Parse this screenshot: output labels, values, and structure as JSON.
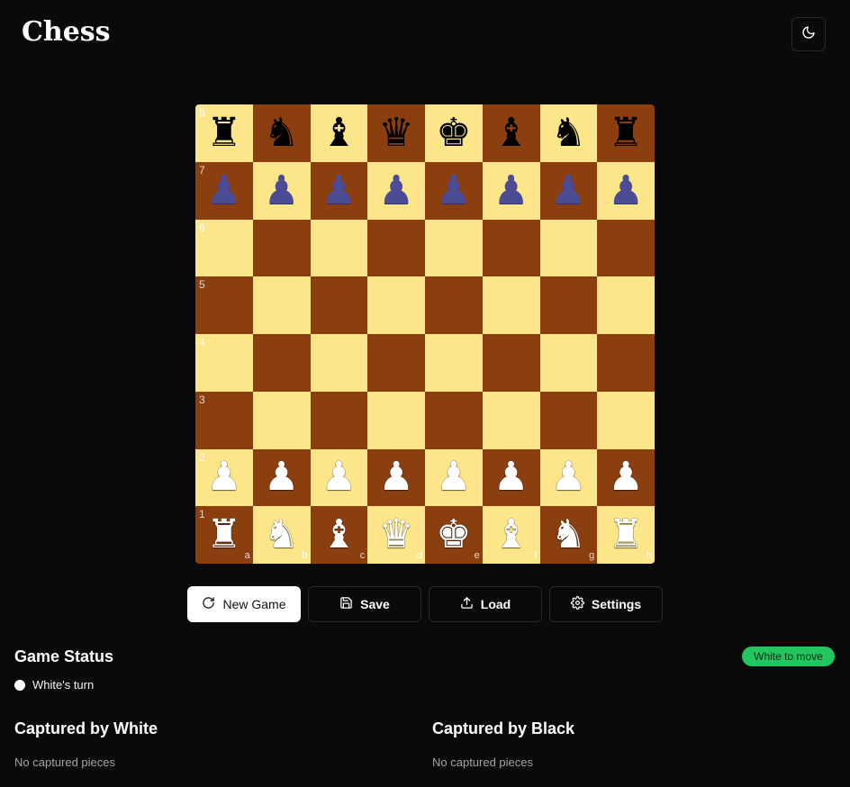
{
  "app": {
    "title": "Chess"
  },
  "theme_toggle": {
    "icon": "moon-icon"
  },
  "board": {
    "ranks": [
      "8",
      "7",
      "6",
      "5",
      "4",
      "3",
      "2",
      "1"
    ],
    "files": [
      "a",
      "b",
      "c",
      "d",
      "e",
      "f",
      "g",
      "h"
    ],
    "light_color": "#fde68a",
    "dark_color": "#8b3f0f",
    "position": [
      [
        "br",
        "bn",
        "bb",
        "bq",
        "bk",
        "bb",
        "bn",
        "br"
      ],
      [
        "bp",
        "bp",
        "bp",
        "bp",
        "bp",
        "bp",
        "bp",
        "bp"
      ],
      [
        "",
        "",
        "",
        "",
        "",
        "",
        "",
        ""
      ],
      [
        "",
        "",
        "",
        "",
        "",
        "",
        "",
        ""
      ],
      [
        "",
        "",
        "",
        "",
        "",
        "",
        "",
        ""
      ],
      [
        "",
        "",
        "",
        "",
        "",
        "",
        "",
        ""
      ],
      [
        "wp",
        "wp",
        "wp",
        "wp",
        "wp",
        "wp",
        "wp",
        "wp"
      ],
      [
        "wr",
        "wn",
        "wb",
        "wq",
        "wk",
        "wb",
        "wn",
        "wr"
      ]
    ]
  },
  "controls": {
    "new_game": "New Game",
    "save": "Save",
    "load": "Load",
    "settings": "Settings"
  },
  "status": {
    "title": "Game Status",
    "badge": "White to move",
    "badge_color": "#22c55e",
    "turn": "White's turn"
  },
  "captured": {
    "by_white_title": "Captured by White",
    "by_white_text": "No captured pieces",
    "by_black_title": "Captured by Black",
    "by_black_text": "No captured pieces"
  }
}
